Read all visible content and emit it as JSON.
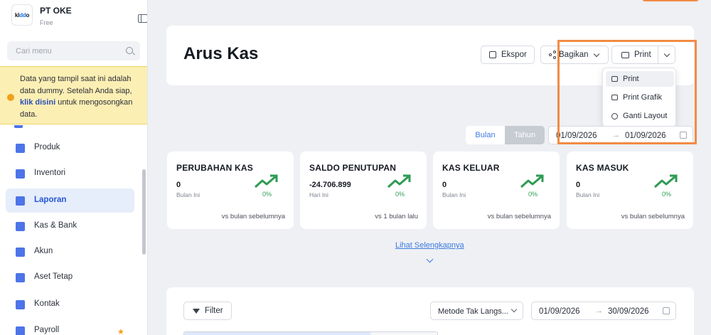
{
  "sidebar": {
    "company": "PT OKE",
    "plan": "Free",
    "logo_text": {
      "a": "kl",
      "b": "dd",
      "c": "o"
    },
    "search_placeholder": "Cari menu",
    "notice": {
      "text_before": "Data yang tampil saat ini adalah data dummy. Setelah Anda siap, ",
      "link": "klik disini",
      "text_after": " untuk mengosongkan data."
    },
    "items": [
      {
        "label": "Produk",
        "icon": "box-icon"
      },
      {
        "label": "Inventori",
        "icon": "warehouse-icon"
      },
      {
        "label": "Laporan",
        "icon": "chart-icon",
        "active": true
      },
      {
        "label": "Kas & Bank",
        "icon": "wallet-icon"
      },
      {
        "label": "Akun",
        "icon": "book-icon"
      },
      {
        "label": "Aset Tetap",
        "icon": "building-icon"
      },
      {
        "label": "Kontak",
        "icon": "contact-card-icon"
      },
      {
        "label": "Payroll",
        "icon": "payroll-icon"
      }
    ]
  },
  "page": {
    "title": "Arus Kas",
    "buttons": {
      "export": "Ekspor",
      "share": "Bagikan",
      "print": "Print"
    },
    "print_menu": [
      "Print",
      "Print Grafik",
      "Ganti Layout"
    ],
    "period_toggle": {
      "month": "Bulan",
      "year": "Tahun",
      "selected": "Tahun"
    },
    "date_range": {
      "start": "01/09/2026",
      "end": "01/09/2026",
      "arrow": "→"
    },
    "more_link": "Lihat Selengkapnya"
  },
  "stats": [
    {
      "title": "PERUBAHAN KAS",
      "value": "0",
      "period": "Bulan Ini",
      "pct": "0%",
      "compare": "vs bulan sebelumnya"
    },
    {
      "title": "SALDO PENUTUPAN",
      "value": "-24.706.899",
      "period": "Hari Ini",
      "pct": "0%",
      "compare": "vs 1 bulan lalu"
    },
    {
      "title": "KAS KELUAR",
      "value": "0",
      "period": "Bulan Ini",
      "pct": "0%",
      "compare": "vs bulan sebelumnya"
    },
    {
      "title": "KAS MASUK",
      "value": "0",
      "period": "Bulan Ini",
      "pct": "0%",
      "compare": "vs bulan sebelumnya"
    }
  ],
  "bottom": {
    "filter": "Filter",
    "method": "Metode Tak Langs...",
    "date_range": {
      "start": "01/09/2026",
      "end": "30/09/2026",
      "arrow": "→"
    }
  },
  "colors": {
    "accent": "#3d7be0",
    "highlight": "#f28b45",
    "trend_up": "#2e9b53",
    "notice_bg": "#fcefb4"
  }
}
